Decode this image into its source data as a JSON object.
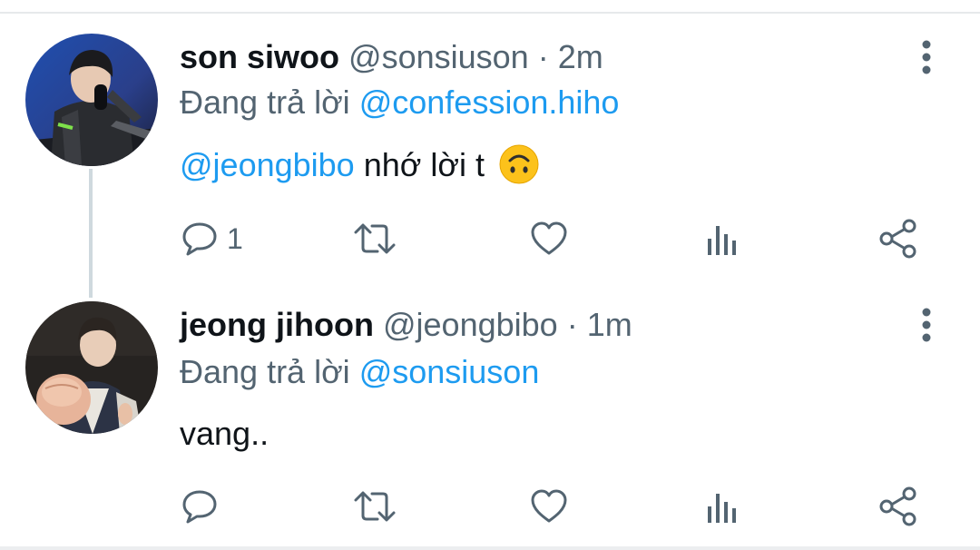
{
  "tweets": [
    {
      "name": "son siwoo",
      "handle": "@sonsiuson",
      "separator": "·",
      "time": "2m",
      "reply_prefix": "Đang trả lời",
      "reply_to": "@confession.hiho",
      "body_mention": "@jeongbibo",
      "body_text": "nhớ lời t",
      "emoji": "upside-down-face-emoji",
      "reply_count": "1"
    },
    {
      "name": "jeong jihoon",
      "handle": "@jeongbibo",
      "separator": "·",
      "time": "1m",
      "reply_prefix": "Đang trả lời",
      "reply_to": "@sonsiuson",
      "body_text": "vang..",
      "reply_count": ""
    }
  ],
  "icons": [
    "reply-icon",
    "retweet-icon",
    "like-icon",
    "analytics-icon",
    "share-icon",
    "more-options-icon"
  ],
  "colors": {
    "link": "#1d9bf0",
    "secondary_text": "#536471",
    "primary_text": "#0f1419",
    "icon": "#536471"
  }
}
